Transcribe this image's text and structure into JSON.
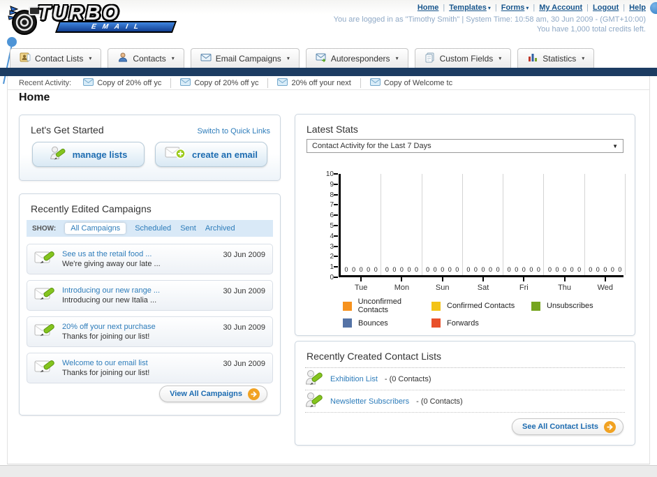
{
  "colors": {
    "navy_bar": "#1c3c62",
    "link_blue": "#2d7cba",
    "button_text_blue": "#1d6cb1",
    "arrow_orange": "#f1a222"
  },
  "header": {
    "logo_title": "TURBO",
    "logo_subtitle": "EMAIL",
    "nav": [
      {
        "label": "Home",
        "caret": false
      },
      {
        "label": "Templates",
        "caret": true
      },
      {
        "label": "Forms",
        "caret": true
      },
      {
        "label": "My Account",
        "caret": false
      },
      {
        "label": "Logout",
        "caret": false
      },
      {
        "label": "Help",
        "caret": false
      }
    ],
    "login_info": "You are logged in as \"Timothy Smith\" | System Time: 10:58 am, 30 Jun 2009 - (GMT+10:00)",
    "credits_info": "You have 1,000 total credits left."
  },
  "main_tabs": [
    {
      "label": "Contact Lists",
      "icon": "contact-lists-icon"
    },
    {
      "label": "Contacts",
      "icon": "contacts-icon"
    },
    {
      "label": "Email Campaigns",
      "icon": "email-campaigns-icon"
    },
    {
      "label": "Autoresponders",
      "icon": "autoresponders-icon"
    },
    {
      "label": "Custom Fields",
      "icon": "custom-fields-icon"
    },
    {
      "label": "Statistics",
      "icon": "statistics-icon"
    }
  ],
  "recent_activity": {
    "label": "Recent Activity:",
    "items": [
      "Copy of 20% off yc",
      "Copy of 20% off yc",
      "20% off your next",
      "Copy of Welcome tc"
    ]
  },
  "page_title": "Home",
  "get_started": {
    "title": "Let's Get Started",
    "switch_link": "Switch to Quick Links",
    "buttons": [
      {
        "label": "manage lists",
        "icon": "manage-lists-icon"
      },
      {
        "label": "create an email",
        "icon": "create-email-icon"
      }
    ]
  },
  "campaigns_panel": {
    "title": "Recently Edited Campaigns",
    "show_label": "SHOW:",
    "filters": [
      {
        "label": "All Campaigns",
        "active": true
      },
      {
        "label": "Scheduled",
        "active": false
      },
      {
        "label": "Sent",
        "active": false
      },
      {
        "label": "Archived",
        "active": false
      }
    ],
    "rows": [
      {
        "title": "See us at the retail food ...",
        "subtitle": "We're giving away our late ...",
        "date": "30 Jun 2009"
      },
      {
        "title": "Introducing our new range ...",
        "subtitle": "Introducing our new Italia ...",
        "date": "30 Jun 2009"
      },
      {
        "title": "20% off your next purchase",
        "subtitle": "Thanks for joining our list!",
        "date": "30 Jun 2009"
      },
      {
        "title": "Welcome to our email list",
        "subtitle": "Thanks for joining our list!",
        "date": "30 Jun 2009"
      }
    ],
    "view_all_label": "View All Campaigns"
  },
  "stats_panel": {
    "title": "Latest Stats",
    "period_selected": "Contact Activity for the Last 7 Days"
  },
  "chart_data": {
    "type": "bar",
    "title": "Contact Activity for the Last 7 Days",
    "categories": [
      "Tue",
      "Mon",
      "Sun",
      "Sat",
      "Fri",
      "Thu",
      "Wed"
    ],
    "series": [
      {
        "name": "Unconfirmed Contacts",
        "color": "#f6921e",
        "values": [
          0,
          0,
          0,
          0,
          0,
          0,
          0
        ]
      },
      {
        "name": "Confirmed Contacts",
        "color": "#f3c317",
        "values": [
          0,
          0,
          0,
          0,
          0,
          0,
          0
        ]
      },
      {
        "name": "Unsubscribes",
        "color": "#76a51f",
        "values": [
          0,
          0,
          0,
          0,
          0,
          0,
          0
        ]
      },
      {
        "name": "Bounces",
        "color": "#5573a6",
        "values": [
          0,
          0,
          0,
          0,
          0,
          0,
          0
        ]
      },
      {
        "name": "Forwards",
        "color": "#e8502a",
        "values": [
          0,
          0,
          0,
          0,
          0,
          0,
          0
        ]
      }
    ],
    "ylim": [
      0,
      10
    ],
    "yticks": [
      0,
      1,
      2,
      3,
      4,
      5,
      6,
      7,
      8,
      9,
      10
    ],
    "grid": "vertical",
    "legend_position": "bottom",
    "value_labels_shown": true
  },
  "contact_lists_panel": {
    "title": "Recently Created Contact Lists",
    "rows": [
      {
        "name": "Exhibition List",
        "suffix": " - (0 Contacts)"
      },
      {
        "name": "Newsletter Subscribers",
        "suffix": " - (0 Contacts)"
      }
    ],
    "see_all_label": "See All Contact Lists"
  }
}
